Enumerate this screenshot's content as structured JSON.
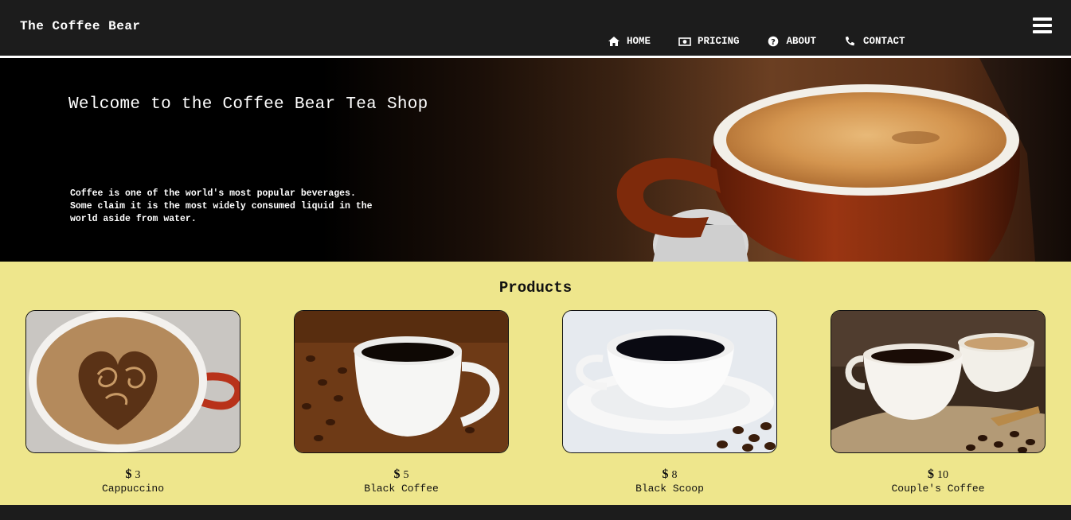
{
  "site": {
    "brand": "The Coffee Bear"
  },
  "nav": {
    "items": [
      {
        "label": "HOME",
        "icon": "home-icon"
      },
      {
        "label": "PRICING",
        "icon": "money-icon"
      },
      {
        "label": "ABOUT",
        "icon": "question-circle-icon"
      },
      {
        "label": "CONTACT",
        "icon": "phone-icon"
      }
    ],
    "menu_icon": "hamburger-menu-icon"
  },
  "hero": {
    "title": "Welcome to the Coffee Bear Tea Shop",
    "text": "Coffee is one of the world's most popular beverages. Some claim it is the most widely consumed liquid in the world aside from water."
  },
  "products": {
    "heading": "Products",
    "currency": "$",
    "items": [
      {
        "price": "3",
        "name": "Cappuccino"
      },
      {
        "price": "5",
        "name": "Black Coffee"
      },
      {
        "price": "8",
        "name": "Black Scoop"
      },
      {
        "price": "10",
        "name": "Couple's Coffee"
      }
    ]
  },
  "colors": {
    "navbar": "#1c1c1c",
    "products_bg": "#eee68c",
    "text_light": "#ffffff",
    "text_dark": "#111111"
  }
}
